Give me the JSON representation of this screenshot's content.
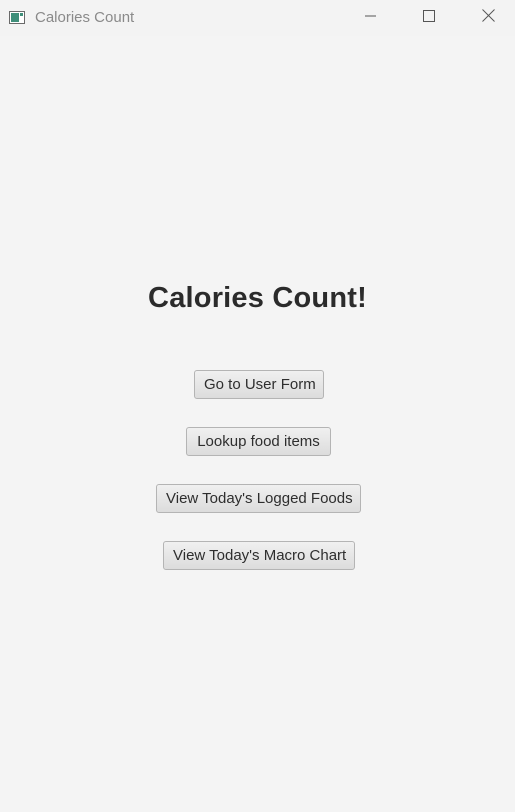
{
  "window": {
    "title": "Calories Count",
    "controls": {
      "minimize_icon": "minimize-icon",
      "maximize_icon": "maximize-icon",
      "close_icon": "close-icon"
    }
  },
  "main": {
    "heading": "Calories Count!",
    "buttons": [
      {
        "label": "Go to User Form"
      },
      {
        "label": "Lookup food items"
      },
      {
        "label": "View Today's Logged Foods"
      },
      {
        "label": "View Today's Macro Chart"
      }
    ]
  },
  "colors": {
    "background": "#f4f4f4",
    "heading_text": "#2b2b2b",
    "button_border": "#b4b4b4"
  }
}
